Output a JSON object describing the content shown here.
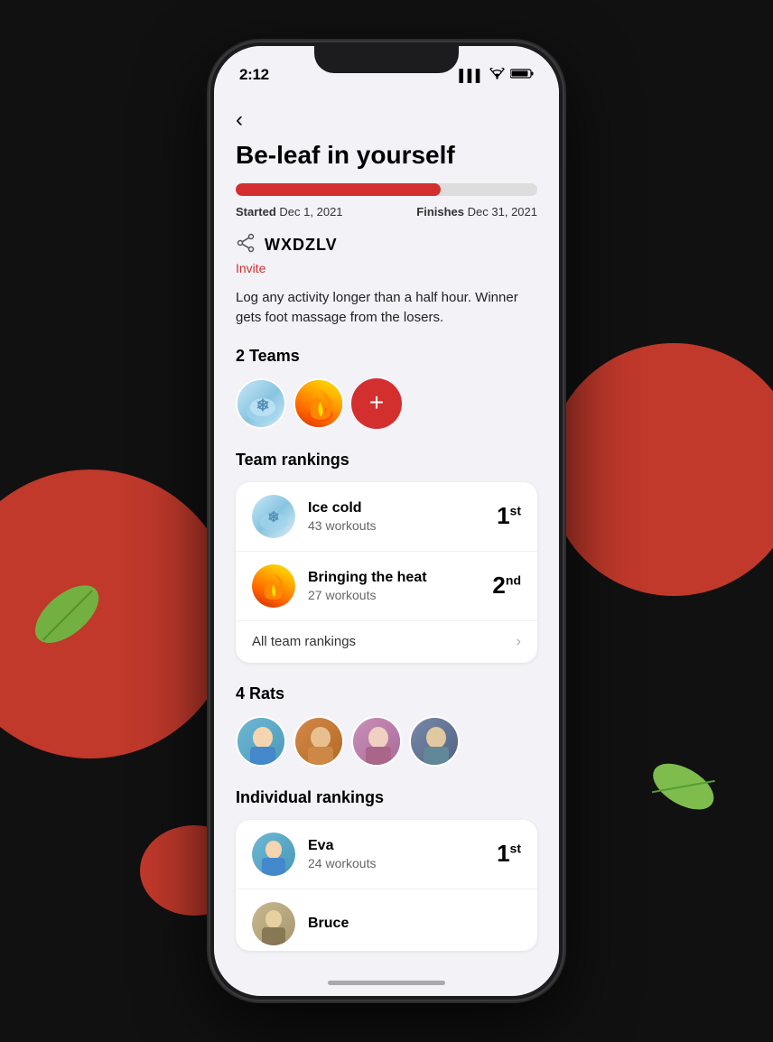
{
  "phone": {
    "status_bar": {
      "time": "2:12",
      "signal_icon": "▌▌▌",
      "wifi_icon": "wifi",
      "battery_icon": "battery"
    }
  },
  "challenge": {
    "title": "Be-leaf in yourself",
    "progress_percent": 68,
    "started_label": "Started",
    "started_date": "Dec 1, 2021",
    "finishes_label": "Finishes",
    "finishes_date": "Dec 31, 2021",
    "invite_code": "WXDZLV",
    "invite_link_label": "Invite",
    "description": "Log any activity longer than a half hour. Winner gets foot massage from the losers.",
    "teams_section_title": "2 Teams",
    "rankings_section_title": "Team rankings",
    "rats_section_title": "4 Rats",
    "individual_section_title": "Individual rankings",
    "all_rankings_label": "All team rankings",
    "team_rankings": [
      {
        "name": "Ice cold",
        "workouts": "43 workouts",
        "rank": "1",
        "rank_suffix": "st",
        "type": "ice"
      },
      {
        "name": "Bringing the heat",
        "workouts": "27 workouts",
        "rank": "2",
        "rank_suffix": "nd",
        "type": "fire"
      }
    ],
    "individual_rankings": [
      {
        "name": "Eva",
        "workouts": "24 workouts",
        "rank": "1",
        "rank_suffix": "st",
        "type": "eva"
      },
      {
        "name": "Bruce",
        "workouts": "",
        "rank": "",
        "rank_suffix": "",
        "type": "bruce"
      }
    ]
  },
  "back_button_label": "‹",
  "icons": {
    "share": "share",
    "add": "+",
    "chevron_right": "›"
  }
}
